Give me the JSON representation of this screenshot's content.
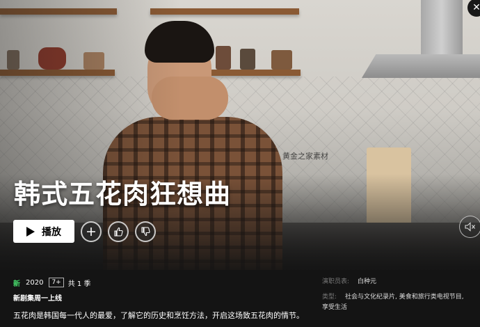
{
  "hero": {
    "title": "韩式五花肉狂想曲",
    "watermark": "黄金之家素材"
  },
  "actions": {
    "play_label": "播放",
    "add_icon": "plus-icon",
    "like_icon": "thumbs-up-icon",
    "dislike_icon": "thumbs-down-icon",
    "mute_icon": "speaker-mute-icon",
    "close_icon": "close-icon"
  },
  "info": {
    "new_label": "新",
    "year": "2020",
    "rating": "7+",
    "seasons": "共 1 季",
    "tagline": "新剧集周一上线",
    "description": "五花肉是韩国每一代人的最爱，了解它的历史和烹饪方法，开启这场致五花肉的情节。"
  },
  "side": {
    "cast_label": "演职员表:",
    "cast_value": "白种元",
    "genre_label": "类型:",
    "genre_value": "社会与文化纪录片, 美食和旅行类电视节目, 享受生活"
  },
  "colors": {
    "background": "#141414",
    "new_green": "#46d369",
    "play_bg": "#ffffff"
  }
}
